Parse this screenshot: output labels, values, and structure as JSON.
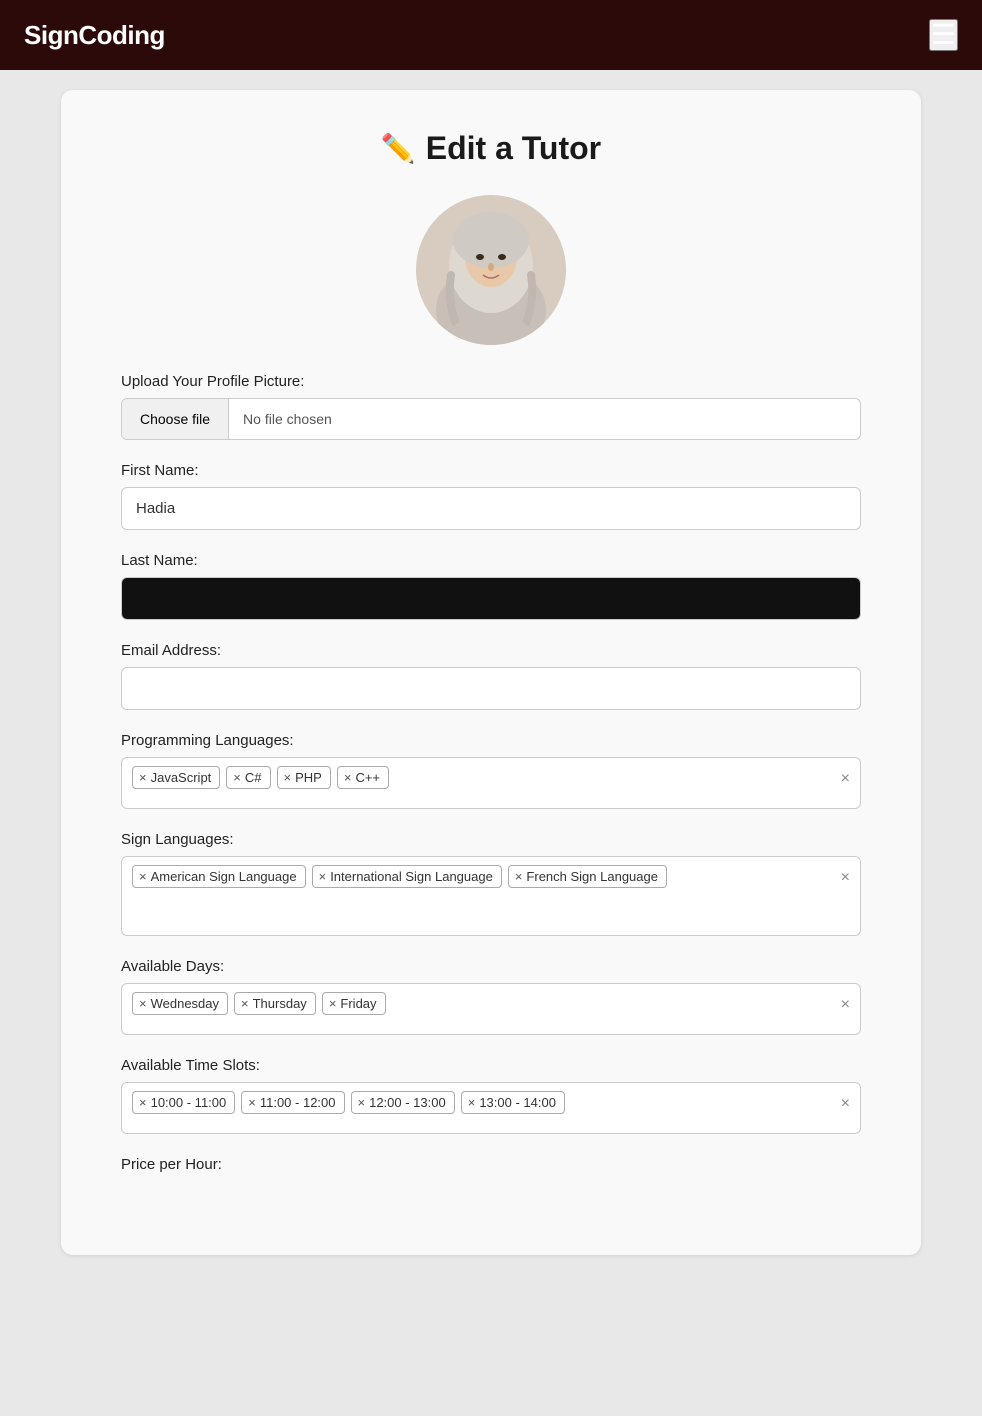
{
  "header": {
    "logo": "SignCoding",
    "menu_icon": "☰"
  },
  "page": {
    "title": "Edit a Tutor",
    "pencil_icon": "✏️"
  },
  "form": {
    "upload_label": "Upload Your Profile Picture:",
    "choose_file_btn": "Choose file",
    "no_file_text": "No file chosen",
    "first_name_label": "First Name:",
    "first_name_value": "Hadia",
    "last_name_label": "Last Name:",
    "last_name_value": "",
    "email_label": "Email Address:",
    "email_value": "",
    "programming_languages_label": "Programming Languages:",
    "programming_languages": [
      "JavaScript",
      "C#",
      "PHP",
      "C++"
    ],
    "sign_languages_label": "Sign Languages:",
    "sign_languages": [
      "American Sign Language",
      "International Sign Language",
      "French Sign Language"
    ],
    "available_days_label": "Available Days:",
    "available_days": [
      "Wednesday",
      "Thursday",
      "Friday"
    ],
    "available_time_slots_label": "Available Time Slots:",
    "available_time_slots": [
      "10:00 - 11:00",
      "11:00 - 12:00",
      "12:00 - 13:00",
      "13:00 - 14:00"
    ],
    "price_per_hour_label": "Price per Hour:"
  }
}
